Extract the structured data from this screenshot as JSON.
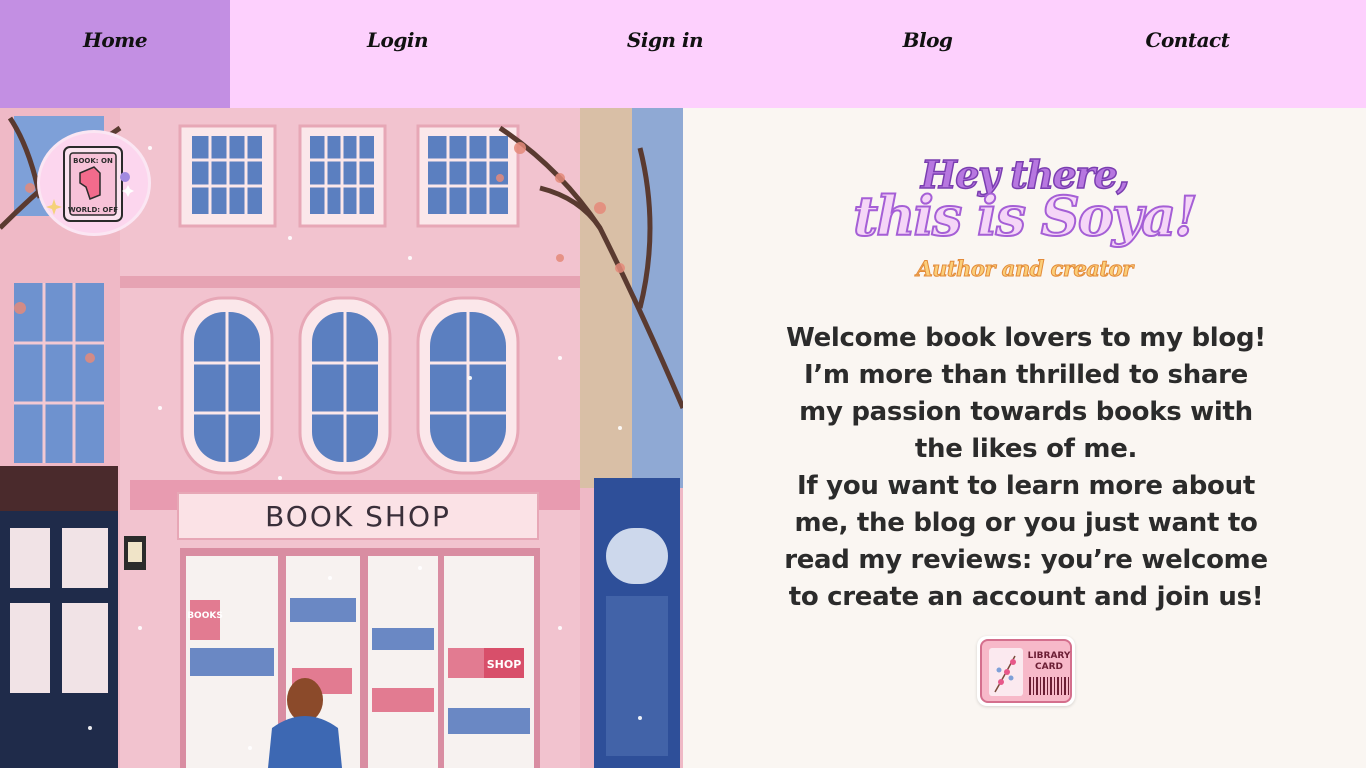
{
  "nav": {
    "items": [
      {
        "id": "home",
        "label": "Home",
        "active": true
      },
      {
        "id": "login",
        "label": "Login",
        "active": false
      },
      {
        "id": "signin",
        "label": "Sign in",
        "active": false
      },
      {
        "id": "blog",
        "label": "Blog",
        "active": false
      },
      {
        "id": "contact",
        "label": "Contact",
        "active": false
      }
    ],
    "bg_color": "#fdd0fd",
    "active_color": "#c38fe3"
  },
  "illustration": {
    "shop_sign": "BOOK  SHOP",
    "window_sign": "SHOP",
    "bookshelf_sign": "BOOKS"
  },
  "logo": {
    "line1": "BOOK: ON",
    "line2": "WORLD: OFF"
  },
  "hero": {
    "greeting": "Hey there,",
    "name": "this is Soya!",
    "role": "Author and creator",
    "welcome_lines": [
      "Welcome book lovers to my blog!",
      "I’m more than thrilled to share my passion towards books with the likes of me.",
      "If you want to learn more about me, the blog or you just want to read my reviews: you’re welcome to create an account and join us!"
    ]
  },
  "library_card": {
    "line1": "LIBRARY",
    "line2": "CARD"
  }
}
